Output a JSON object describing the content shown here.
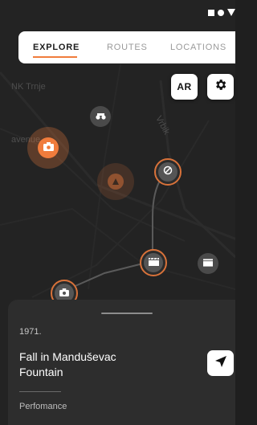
{
  "tabs": [
    {
      "label": "EXPLORE",
      "active": true
    },
    {
      "label": "ROUTES",
      "active": false
    },
    {
      "label": "LOCATIONS",
      "active": false
    }
  ],
  "map_buttons": {
    "ar_label": "AR",
    "settings_icon": "gear-icon"
  },
  "map_labels": {
    "street_1": "NK Trnje",
    "street_2": "avenue",
    "street_3": "Vrbik"
  },
  "markers": [
    {
      "name": "camera",
      "icon": "camera-icon",
      "state": "selected"
    },
    {
      "name": "binoculars",
      "icon": "binoculars-icon",
      "state": "default"
    },
    {
      "name": "small",
      "icon": "info-icon",
      "state": "faded"
    },
    {
      "name": "route-stop",
      "icon": "route-icon",
      "state": "route"
    },
    {
      "name": "film",
      "icon": "film-icon",
      "state": "route"
    },
    {
      "name": "film",
      "icon": "film-icon",
      "state": "default"
    },
    {
      "name": "camera",
      "icon": "camera-icon",
      "state": "route"
    }
  ],
  "detail": {
    "year": "1971.",
    "title": "Fall in  Manduševac\nFountain",
    "category": "Perfomance",
    "navigate_icon": "navigation-arrow-icon"
  },
  "colors": {
    "accent": "#f07c3c",
    "map_bg": "#232323",
    "sheet_bg": "#2d2d2d"
  }
}
